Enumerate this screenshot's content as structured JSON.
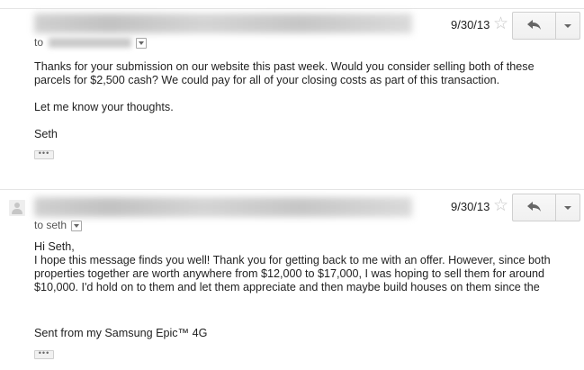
{
  "messages": [
    {
      "date": "9/30/13",
      "recipient_prefix": "to",
      "paragraphs": [
        "Thanks for your submission on our website this past week. Would you consider selling both of these parcels for $2,500 cash? We could pay for all of your closing costs as part of this transaction.",
        "Let me know your thoughts.",
        "Seth"
      ],
      "dots": "•••"
    },
    {
      "date": "9/30/13",
      "recipient": "to seth",
      "greeting": "Hi Seth,",
      "body": "I hope this message finds you well! Thank you for getting back to me with an offer. However, since both properties together are worth anywhere from $12,000 to $17,000, I was hoping to sell them for around $10,000. I'd hold on to them and let them appreciate and then maybe build houses on them since the",
      "signature": "Sent from my Samsung Epic™ 4G",
      "dots": "•••"
    }
  ],
  "icons": {
    "star": "☆",
    "reply": "reply-arrow",
    "more": "chevron-down"
  },
  "colors": {
    "divider": "#e5e5e5",
    "text": "#222222",
    "star": "#c6c6c6"
  }
}
